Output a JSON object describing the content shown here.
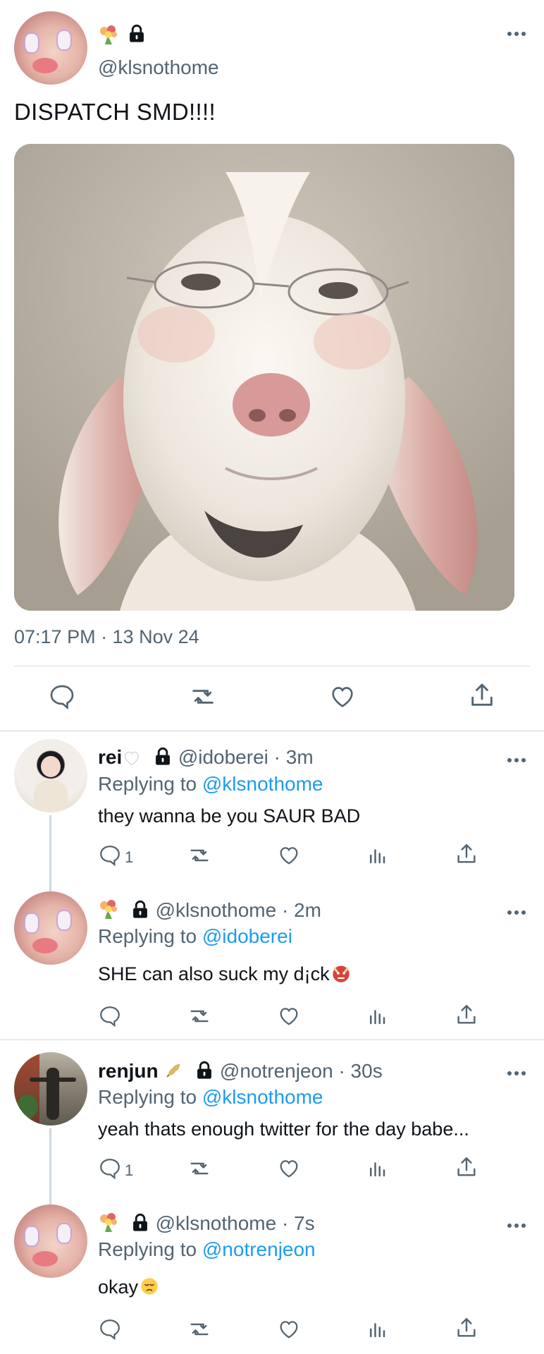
{
  "main_tweet": {
    "handle": "@klsnothome",
    "text": "DISPATCH SMD!!!!",
    "timestamp": "07:17 PM · 13 Nov 24",
    "media_description": "goat-with-glasses-photo"
  },
  "replies": [
    {
      "name": "rei",
      "handle": "@idoberei",
      "time": "· 3m",
      "replying_prefix": "Replying to",
      "replying_to": "@klsnothome",
      "text": "they wanna be you SAUR BAD",
      "reply_count": "1"
    },
    {
      "name": "",
      "handle": "@klsnothome",
      "time": "· 2m",
      "replying_prefix": "Replying to",
      "replying_to": "@idoberei",
      "text": "SHE can also suck my d¡ck",
      "reply_count": ""
    },
    {
      "name": "renjun",
      "handle": "@notrenjeon",
      "time": "· 30s",
      "replying_prefix": "Replying to",
      "replying_to": "@klsnothome",
      "text": "yeah thats enough twitter for the day babe...",
      "reply_count": "1"
    },
    {
      "name": "",
      "handle": "@klsnothome",
      "time": "· 7s",
      "replying_prefix": "Replying to",
      "replying_to": "@notrenjeon",
      "text": "okay",
      "reply_count": ""
    }
  ],
  "colors": {
    "link": "#1d9bf0",
    "secondary_text": "#536471",
    "primary_text": "#0f1419",
    "divider": "#d7dbde"
  }
}
